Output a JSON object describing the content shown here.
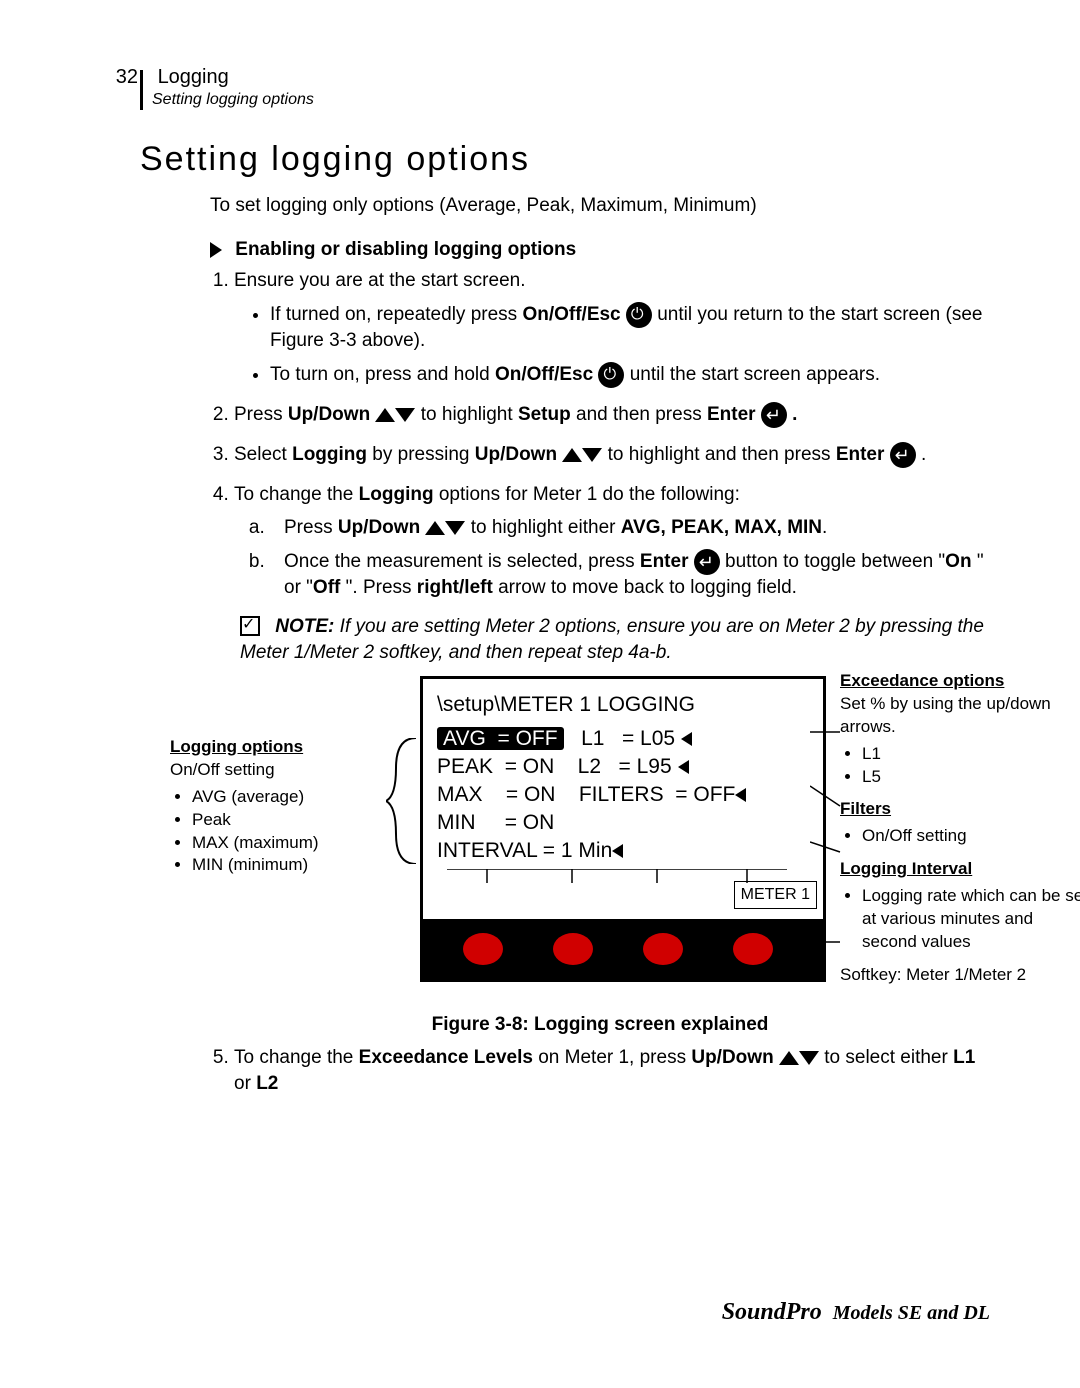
{
  "header": {
    "page_num": "32",
    "section": "Logging",
    "subsection": "Setting logging options"
  },
  "title": "Setting logging options",
  "intro": "To set logging only options (Average, Peak, Maximum, Minimum)",
  "enable_heading": "Enabling or disabling logging options",
  "step1": "Ensure you are at the start screen.",
  "step1a_pre": "If turned on, repeatedly press ",
  "step1a_key": "On/Off/Esc",
  "step1a_post": " until you return to the start screen (see Figure 3-3 above).",
  "step1b_pre": "To turn on, press and hold ",
  "step1b_key": "On/Off/Esc",
  "step1b_post": " until the start screen appears.",
  "step2_pre": "Press ",
  "step2_key": "Up/Down",
  "step2_mid": " to highlight ",
  "step2_setup": "Setup",
  "step2_mid2": " and then press ",
  "step2_enter": "Enter",
  "step2_end": " .",
  "step3_pre": "Select ",
  "step3_log": "Logging",
  "step3_mid": " by pressing ",
  "step3_key": "Up/Down",
  "step3_mid2": " to highlight and then press ",
  "step3_enter": "Enter",
  "step3_end": " .",
  "step4_pre": "To change the ",
  "step4_log": "Logging",
  "step4_post": " options for Meter 1 do the following:",
  "step4a_pre": "Press ",
  "step4a_key": "Up/Down",
  "step4a_mid": " to highlight either ",
  "step4a_opts": "AVG, PEAK, MAX, MIN",
  "step4a_end": ".",
  "step4b_pre": "Once the measurement is selected, press ",
  "step4b_enter": "Enter",
  "step4b_mid": " button to toggle between \"",
  "step4b_on": "On",
  "step4b_mid2": "\" or \"",
  "step4b_off": "Off",
  "step4b_mid3": "\".   Press ",
  "step4b_rl": "right/left",
  "step4b_end": " arrow to move back to logging field.",
  "note_label": "NOTE:",
  "note_text": "  If you are setting Meter 2 options, ensure you are on Meter 2 by pressing the Meter 1/Meter 2 softkey, and then repeat step 4a-b.",
  "side_left": {
    "heading": "Logging options",
    "sub": "On/Off setting",
    "items": [
      "AVG (average)",
      "Peak",
      "MAX (maximum)",
      "MIN (minimum)"
    ]
  },
  "screen": {
    "path": "\\setup\\METER 1 LOGGING",
    "r1a": "AVG",
    "r1b": "= OFF",
    "r1c": "L1",
    "r1d": "= L05",
    "r2a": "PEAK",
    "r2b": "= ON",
    "r2c": "L2",
    "r2d": "= L95",
    "r3a": "MAX",
    "r3b": "= ON",
    "r3c": "FILTERS",
    "r3d": "= OFF",
    "r4a": "MIN",
    "r4b": "= ON",
    "r5": "INTERVAL     =       1  Min",
    "meter": "METER 1"
  },
  "side_right": {
    "exc_h": "Exceedance options",
    "exc_t": "Set % by using the up/down arrows.",
    "exc_items": [
      "L1",
      "L5"
    ],
    "fil_h": "Filters",
    "fil_items": [
      "On/Off setting"
    ],
    "int_h": "Logging Interval",
    "int_items": [
      "Logging rate which can be set at  various minutes and second values"
    ],
    "softkey": "Softkey:  Meter 1/Meter 2"
  },
  "figcaption": "Figure 3-8:  Logging screen explained",
  "step5_pre": "To change the ",
  "step5_exc": "Exceedance Levels",
  "step5_mid": " on Meter 1, press ",
  "step5_key": "Up/Down",
  "step5_mid2": " to select either ",
  "step5_l1": "L1",
  "step5_or": " or ",
  "step5_l2": "L2",
  "footer_brand": "SoundPro",
  "footer_text": " Models SE and DL"
}
